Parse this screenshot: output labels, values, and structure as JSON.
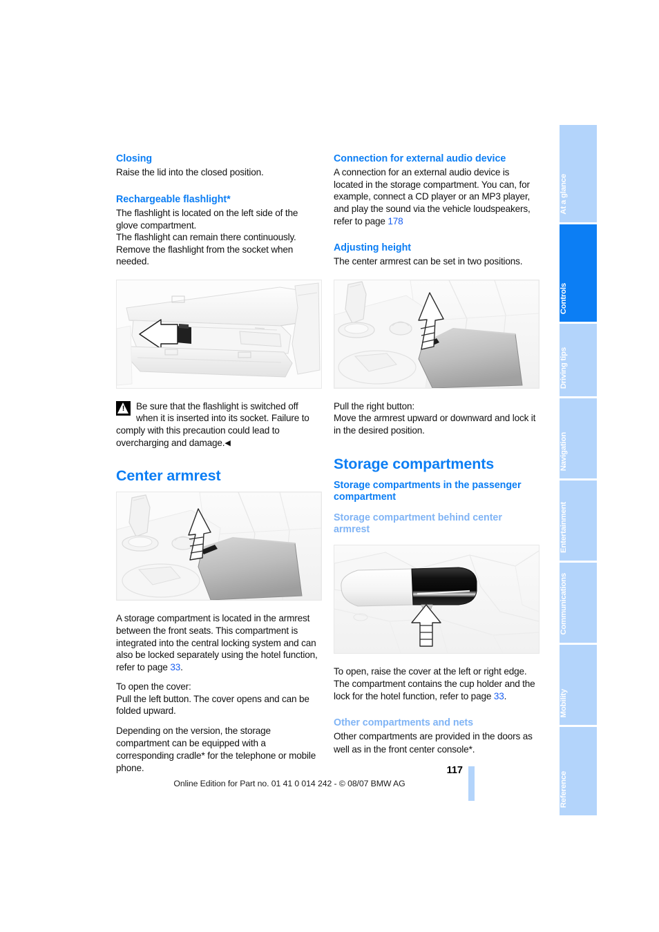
{
  "document": {
    "page_number": "117",
    "footer_text": "Online Edition for Part no. 01 41 0 014 242 - © 08/07 BMW AG"
  },
  "register": {
    "tabs": [
      {
        "label": "At a glance",
        "active": false
      },
      {
        "label": "Controls",
        "active": true
      },
      {
        "label": "Driving tips",
        "active": false
      },
      {
        "label": "Navigation",
        "active": false
      },
      {
        "label": "Entertainment",
        "active": false
      },
      {
        "label": "Communications",
        "active": false
      },
      {
        "label": "Mobility",
        "active": false
      },
      {
        "label": "Reference",
        "active": false
      }
    ]
  },
  "colors": {
    "heading_blue": "#0c7ef4",
    "subheading_light_blue": "#80b4f5",
    "page_ref_blue": "#1a5ff0",
    "tab_inactive": "#b3d4fb",
    "tab_active": "#0c7ef4"
  },
  "left_column": {
    "closing": {
      "heading": "Closing",
      "body": "Raise the lid into the closed position."
    },
    "flashlight": {
      "heading": "Rechargeable flashlight*",
      "body": "The flashlight is located on the left side of the glove compartment.\nThe flashlight can remain there continuously. Remove the flashlight from the socket when needed."
    },
    "figure_glovebox": {
      "caption_code": "",
      "alt": "Open glove compartment with flashlight socket, left-pointing arrow"
    },
    "warning": {
      "icon": "warning-triangle-icon",
      "text": "Be sure that the flashlight is switched off when it is inserted into its socket. Failure to comply with this precaution could lead to overcharging and damage.",
      "end_mark": "◀"
    },
    "center_armrest": {
      "heading": "Center armrest",
      "figure_alt": "Center console armrest with upward arrow at release button",
      "para1_before_ref": "A storage compartment is located in the armrest between the front seats. This compartment is integrated into the central locking system and can also be locked separately using the hotel function, refer to page ",
      "para1_ref": "33",
      "para1_after_ref": ".",
      "para2": "To open the cover:\nPull the left button. The cover opens and can be folded upward.",
      "para3_before_star": "Depending on the version, the storage compartment can be equipped with a corresponding cradle",
      "para3_star": "*",
      "para3_after_star": " for the telephone or mobile phone."
    }
  },
  "right_column": {
    "audio": {
      "heading": "Connection for external audio device",
      "body_before_ref": "A connection for an external audio device is located in the storage compartment. You can, for example, connect a CD player or an MP3 player, and play the sound via the vehicle loudspeakers, refer to page ",
      "body_ref": "178",
      "body_after_ref": ""
    },
    "adjusting_height": {
      "heading": "Adjusting height",
      "body": "The center armrest can be set in two positions.",
      "figure_alt": "Center console armrest height adjustment with upward arrow",
      "after_figure": "Pull the right button:\nMove the armrest upward or downward and lock it in the desired position."
    },
    "storage": {
      "heading": "Storage compartments",
      "sub_heading": "Storage compartments in the passenger compartment",
      "subsub_heading": "Storage compartment behind center armrest",
      "figure_alt": "Rear center armrest storage compartment with upward arrow",
      "body_before_ref": "To open, raise the cover at the left or right edge. The compartment contains the cup holder and the lock for the hotel function, refer to page ",
      "body_ref": "33",
      "body_after_ref": "."
    },
    "other": {
      "heading": "Other compartments and nets",
      "body_before_star": "Other compartments are provided in the doors as well as in the front center console",
      "body_star": "*",
      "body_after_star": "."
    }
  }
}
